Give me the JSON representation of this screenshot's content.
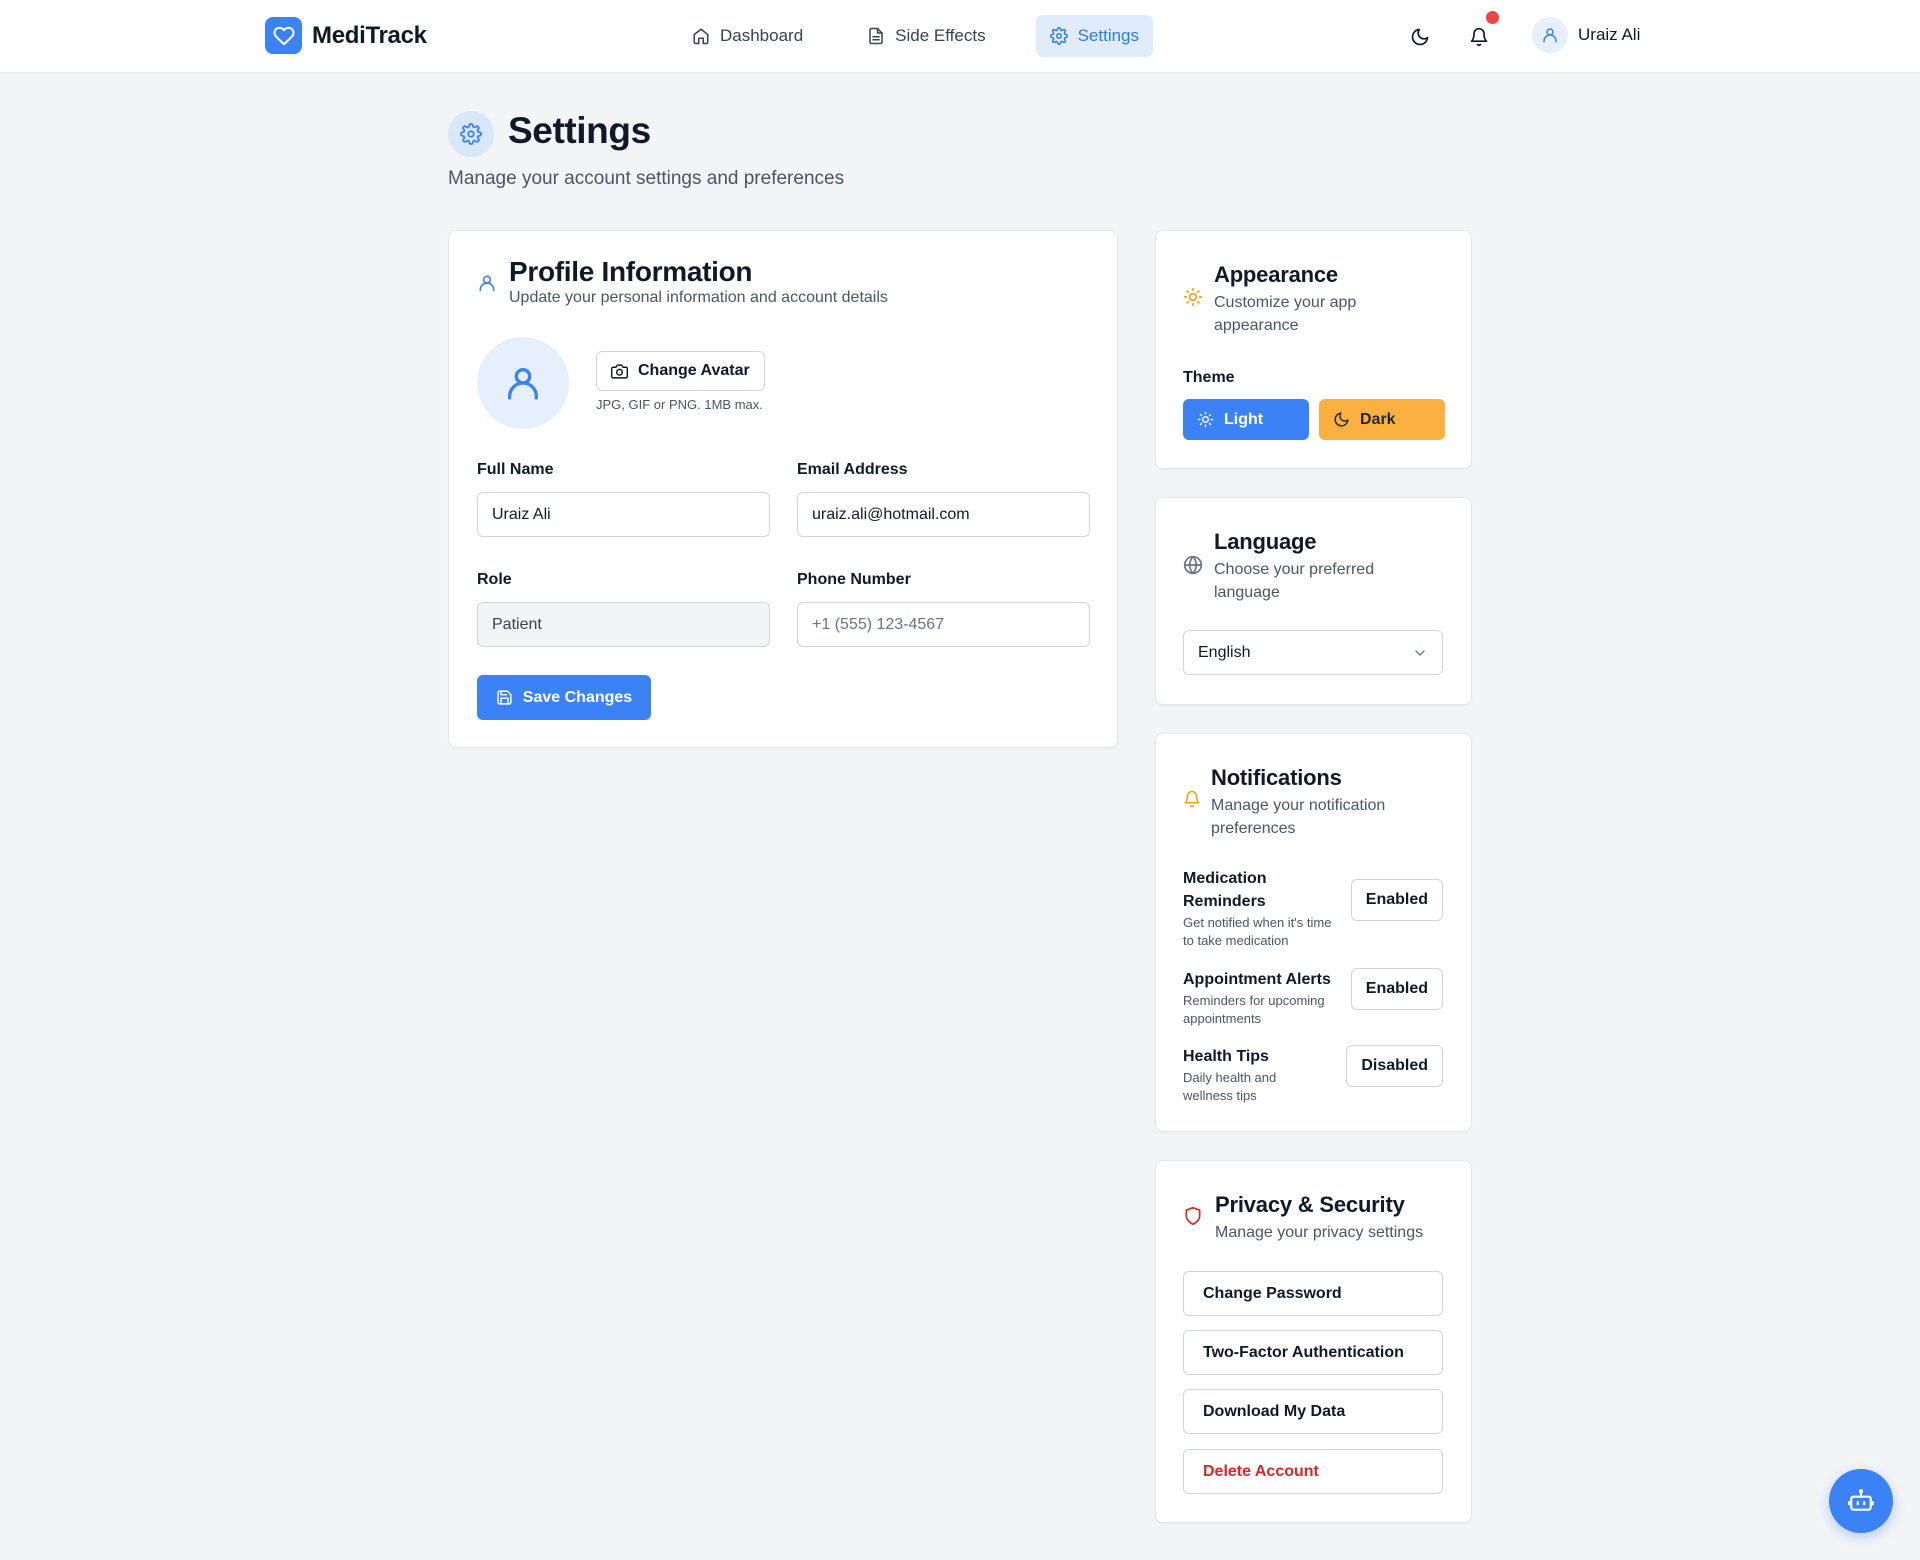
{
  "header": {
    "app_name": "MediTrack",
    "nav": [
      {
        "label": "Dashboard",
        "icon": "home-icon"
      },
      {
        "label": "Side Effects",
        "icon": "document-icon"
      },
      {
        "label": "Settings",
        "icon": "gear-icon",
        "active": true
      }
    ],
    "user_name": "Uraiz Ali",
    "has_unread_notifications": true
  },
  "page": {
    "title": "Settings",
    "subtitle": "Manage your account settings and preferences"
  },
  "profile": {
    "title": "Profile Information",
    "subtitle": "Update your personal information and account details",
    "change_avatar_label": "Change Avatar",
    "avatar_hint": "JPG, GIF or PNG. 1MB max.",
    "full_name_label": "Full Name",
    "full_name_value": "Uraiz Ali",
    "email_label": "Email Address",
    "email_value": "uraiz.ali@hotmail.com",
    "role_label": "Role",
    "role_value": "Patient",
    "phone_label": "Phone Number",
    "phone_placeholder": "+1 (555) 123-4567",
    "save_label": "Save Changes"
  },
  "appearance": {
    "title": "Appearance",
    "subtitle": "Customize your app appearance",
    "theme_label": "Theme",
    "light_label": "Light",
    "dark_label": "Dark"
  },
  "language": {
    "title": "Language",
    "subtitle": "Choose your preferred language",
    "selected": "English"
  },
  "notifications": {
    "title": "Notifications",
    "subtitle": "Manage your notification preferences",
    "items": [
      {
        "title": "Medication Reminders",
        "desc": "Get notified when it's time to take medication",
        "status": "Enabled"
      },
      {
        "title": "Appointment Alerts",
        "desc": "Reminders for upcoming appointments",
        "status": "Enabled"
      },
      {
        "title": "Health Tips",
        "desc": "Daily health and wellness tips",
        "status": "Disabled"
      }
    ]
  },
  "privacy": {
    "title": "Privacy & Security",
    "subtitle": "Manage your privacy settings",
    "actions": [
      "Change Password",
      "Two-Factor Authentication",
      "Download My Data",
      "Delete Account"
    ]
  },
  "colors": {
    "primary": "#3b82f6",
    "active_nav_bg": "#e0ecfc",
    "dark_theme_btn": "#fbb040",
    "danger": "#dc2626",
    "notification_dot": "#ef4444",
    "page_bg": "#f3f4f6"
  }
}
